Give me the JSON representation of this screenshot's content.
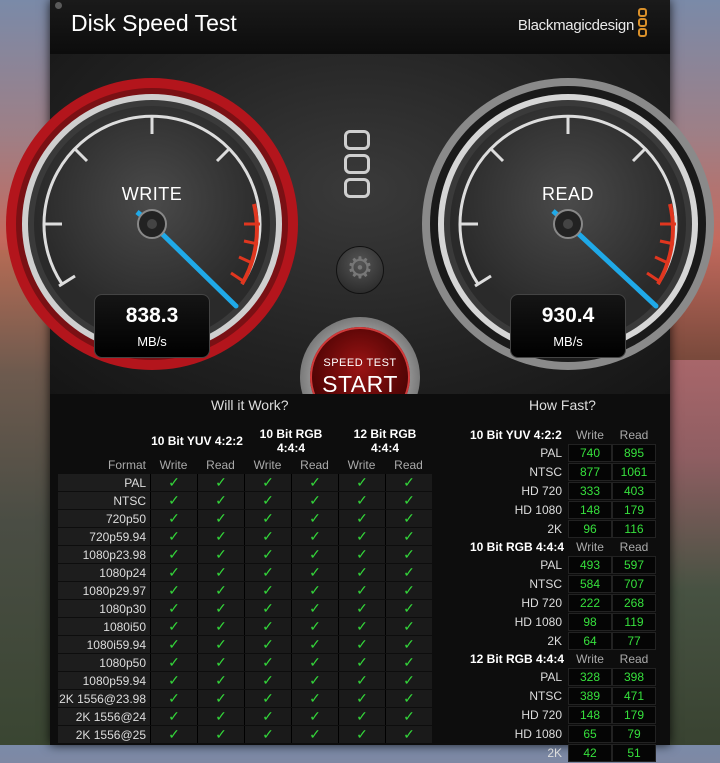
{
  "app": {
    "title": "Disk Speed Test",
    "brand": "Blackmagicdesign"
  },
  "colors": {
    "check": "#33d63a",
    "number": "#36e03c",
    "write_ring": "#b3151c",
    "needle": "#1fa9e8"
  },
  "write_gauge": {
    "label": "WRITE",
    "value": "838.3",
    "unit": "MB/s"
  },
  "read_gauge": {
    "label": "READ",
    "value": "930.4",
    "unit": "MB/s"
  },
  "start_button": {
    "line1": "SPEED TEST",
    "line2": "START"
  },
  "will_it_work": {
    "heading": "Will it Work?",
    "format_label": "Format",
    "groups": [
      "10 Bit YUV 4:2:2",
      "10 Bit RGB 4:4:4",
      "12 Bit RGB 4:4:4"
    ],
    "write_label": "Write",
    "read_label": "Read",
    "formats": [
      "PAL",
      "NTSC",
      "720p50",
      "720p59.94",
      "1080p23.98",
      "1080p24",
      "1080p29.97",
      "1080p30",
      "1080i50",
      "1080i59.94",
      "1080p50",
      "1080p59.94",
      "2K 1556@23.98",
      "2K 1556@24",
      "2K 1556@25"
    ],
    "check": "✓"
  },
  "how_fast": {
    "heading": "How Fast?",
    "write_label": "Write",
    "read_label": "Read",
    "groups": [
      {
        "name": "10 Bit YUV 4:2:2",
        "rows": [
          [
            "PAL",
            "740",
            "895"
          ],
          [
            "NTSC",
            "877",
            "1061"
          ],
          [
            "HD 720",
            "333",
            "403"
          ],
          [
            "HD 1080",
            "148",
            "179"
          ],
          [
            "2K",
            "96",
            "116"
          ]
        ]
      },
      {
        "name": "10 Bit RGB 4:4:4",
        "rows": [
          [
            "PAL",
            "493",
            "597"
          ],
          [
            "NTSC",
            "584",
            "707"
          ],
          [
            "HD 720",
            "222",
            "268"
          ],
          [
            "HD 1080",
            "98",
            "119"
          ],
          [
            "2K",
            "64",
            "77"
          ]
        ]
      },
      {
        "name": "12 Bit RGB 4:4:4",
        "rows": [
          [
            "PAL",
            "328",
            "398"
          ],
          [
            "NTSC",
            "389",
            "471"
          ],
          [
            "HD 720",
            "148",
            "179"
          ],
          [
            "HD 1080",
            "65",
            "79"
          ],
          [
            "2K",
            "42",
            "51"
          ]
        ]
      }
    ]
  }
}
